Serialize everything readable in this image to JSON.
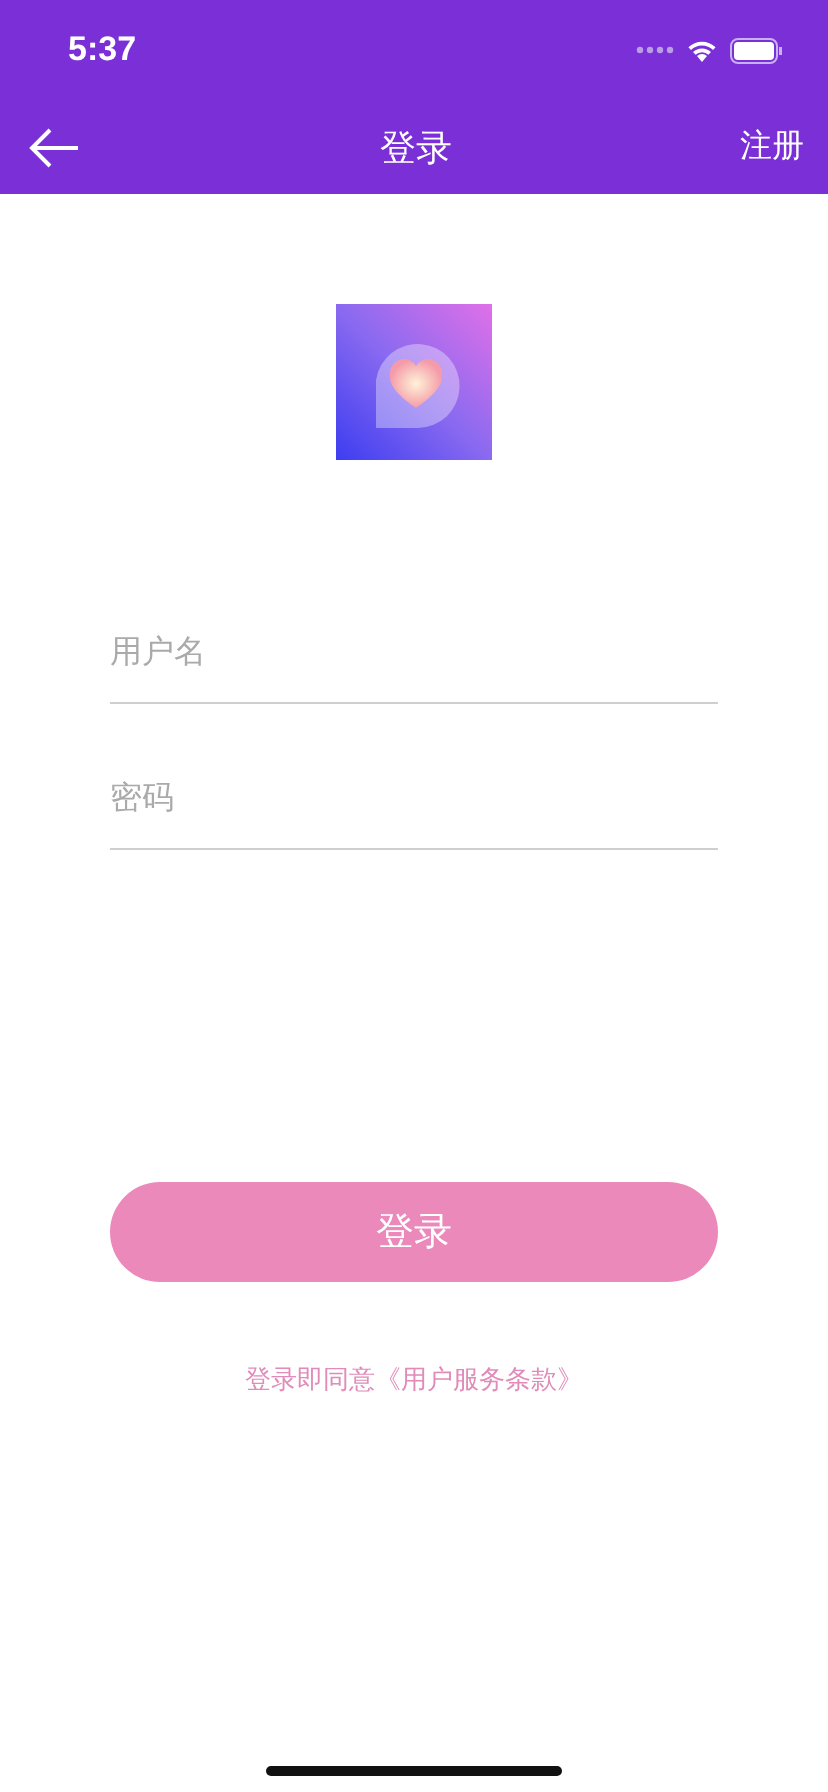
{
  "status_bar": {
    "time": "5:37"
  },
  "nav": {
    "title": "登录",
    "action": "注册"
  },
  "fields": [
    {
      "placeholder": "用户名"
    },
    {
      "placeholder": "密码"
    }
  ],
  "submit": "登录",
  "agreement": "登录即同意《用户服务条款》"
}
